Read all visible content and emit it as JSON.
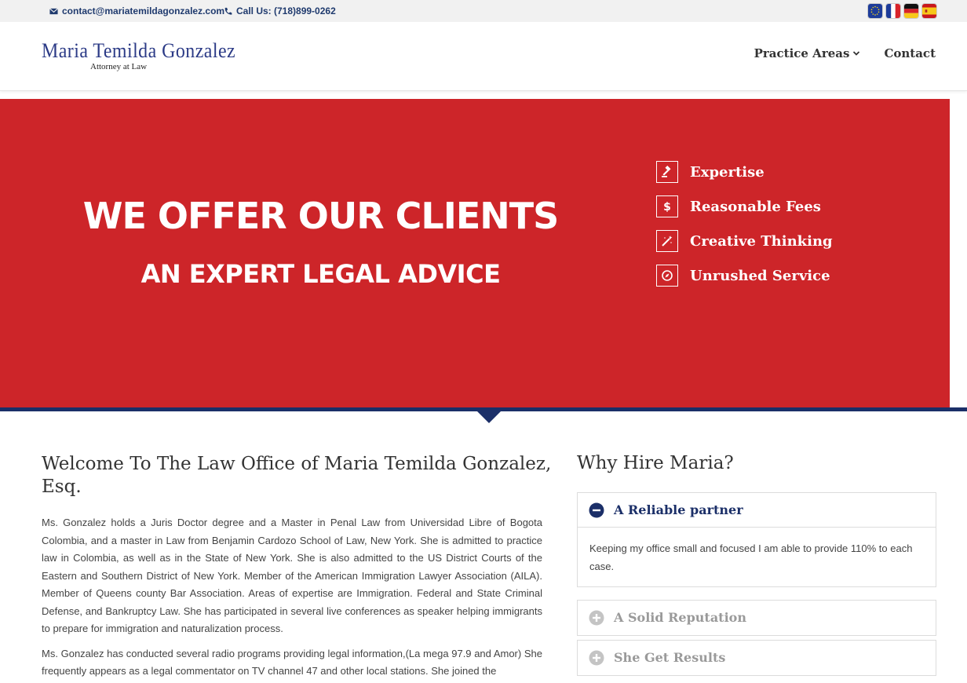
{
  "topbar": {
    "email": "contact@mariatemildagonzalez.com",
    "phone": "Call Us: (718)899-0262",
    "flags": [
      "eu-flag",
      "fr-flag",
      "de-flag",
      "es-flag"
    ]
  },
  "header": {
    "logo_name": "Maria Temilda Gonzalez",
    "logo_sub": "Attorney at Law",
    "nav": {
      "practice_areas": "Practice Areas",
      "contact": "Contact"
    }
  },
  "hero": {
    "title": "WE OFFER OUR CLIENTS",
    "subtitle": "AN EXPERT LEGAL ADVICE",
    "features": [
      {
        "icon": "gavel-icon",
        "label": "Expertise"
      },
      {
        "icon": "dollar-icon",
        "label": "Reasonable Fees"
      },
      {
        "icon": "magic-wand-icon",
        "label": "Creative Thinking"
      },
      {
        "icon": "compass-icon",
        "label": "Unrushed Service"
      }
    ]
  },
  "welcome": {
    "title": "Welcome To The Law Office of Maria Temilda Gonzalez, Esq.",
    "paragraphs": [
      "Ms. Gonzalez holds a Juris Doctor degree and a Master in Penal Law from Universidad Libre of Bogota Colombia, and a master in Law from Benjamin Cardozo School of Law, New York. She is admitted to practice law in Colombia, as well as in the State of New York. She is also admitted to the US District Courts of the Eastern and Southern District of New York. Member of the American Immigration Lawyer Association (AILA). Member of Queens county Bar Association. Areas of expertise are Immigration. Federal and State Criminal Defense, and Bankruptcy Law. She has participated in several live conferences as speaker helping immigrants to prepare for immigration and naturalization process.",
      "Ms. Gonzalez has conducted several radio programs providing legal information,(La mega 97.9 and Amor) She frequently appears as a legal commentator on TV channel 47 and other local stations. She joined the"
    ]
  },
  "why": {
    "title": "Why Hire Maria?",
    "items": [
      {
        "label": "A Reliable partner",
        "body": "Keeping my office small and focused I am able to provide 110% to each case.",
        "open": true
      },
      {
        "label": "A Solid Reputation",
        "open": false
      },
      {
        "label": "She Get Results",
        "open": false
      }
    ]
  },
  "colors": {
    "hero_red": "#cd2529",
    "navy": "#1b2f68",
    "logo_blue": "#2b3a86"
  }
}
